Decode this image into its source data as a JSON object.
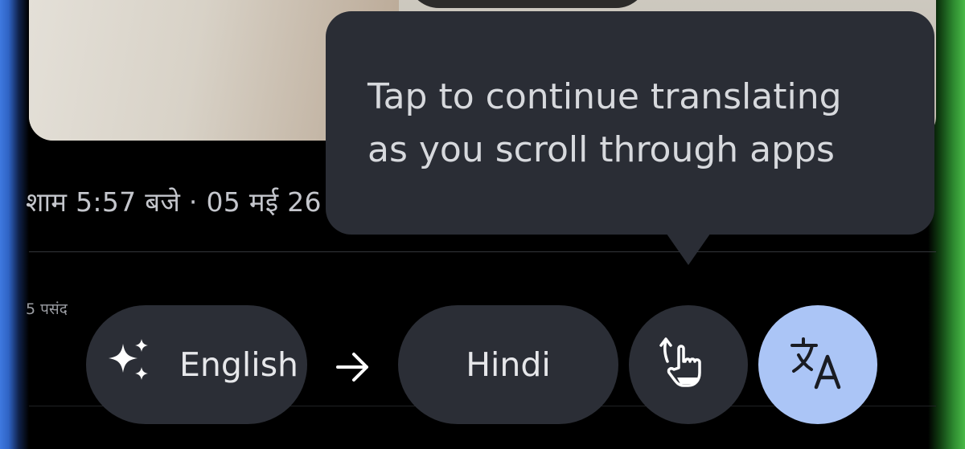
{
  "timestamp": "शाम 5:57 बजे · 05 मई 26",
  "likes_text": "5 पसंद",
  "tooltip": {
    "line1": "Tap to continue translating",
    "line2": "as you scroll through apps"
  },
  "translate_bar": {
    "source_language": "English",
    "source_icon": "sparkle-icon",
    "arrow_icon": "arrow-right-icon",
    "target_language": "Hindi",
    "scroll_button_icon": "scroll-gesture-icon",
    "translate_button_icon": "translate-icon"
  },
  "colors": {
    "tooltip_bg": "#2a2d35",
    "pill_bg": "#2b2e36",
    "translate_button_bg": "#abc5f6",
    "text_light": "#e6e7ea"
  }
}
